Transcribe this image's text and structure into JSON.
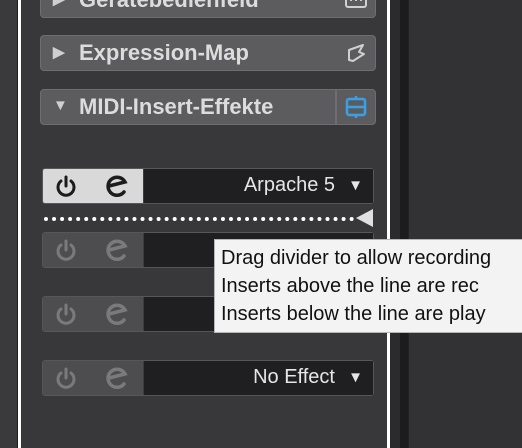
{
  "sections": {
    "geraete": {
      "label": "Gerätebedienfeld"
    },
    "expression": {
      "label": "Expression-Map"
    },
    "midi_inserts": {
      "label": "MIDI-Insert-Effekte"
    }
  },
  "slots": [
    {
      "name": "Arpache 5",
      "active": true
    },
    {
      "name": "",
      "active": false
    },
    {
      "name": "",
      "active": false
    },
    {
      "name": "No Effect",
      "active": false
    }
  ],
  "dropdown_arrow": "▼",
  "tooltip": {
    "lines": [
      "Drag divider to allow recording",
      "Inserts above the line are rec",
      "Inserts below the line are play"
    ]
  },
  "colors": {
    "accent": "#3aa0e6",
    "panel": "#38383a",
    "section": "#5c5c5f",
    "tooltip_bg": "#f3f3f3"
  },
  "icons": [
    "keyboard-icon",
    "expression-map-icon",
    "edit-inserts-icon",
    "power-icon",
    "edit-e-icon",
    "divider-handle-icon"
  ]
}
